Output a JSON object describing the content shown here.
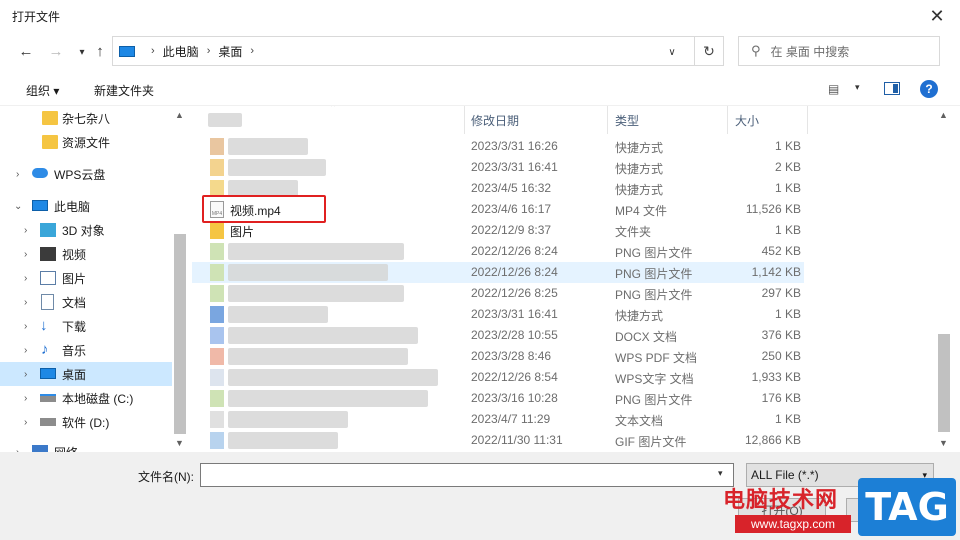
{
  "window": {
    "title": "打开文件"
  },
  "nav": {
    "back": "←",
    "forward": "→",
    "up": "↑",
    "refresh": "↻",
    "address_crumbs": [
      "此电脑",
      "桌面"
    ],
    "search_placeholder": "在 桌面 中搜索"
  },
  "toolbar": {
    "organize": "组织 ▾",
    "new_folder": "新建文件夹",
    "view_icon": "▤",
    "view_dd": "▾",
    "help": "?"
  },
  "sidebar": {
    "items": [
      {
        "label": "杂七杂八",
        "icon": "folder-icon"
      },
      {
        "label": "资源文件",
        "icon": "folder-icon"
      },
      {
        "label": "WPS云盘",
        "icon": "cloud-icon"
      },
      {
        "label": "此电脑",
        "icon": "pc-icon"
      },
      {
        "label": "3D 对象",
        "icon": "3d-objects-icon"
      },
      {
        "label": "视频",
        "icon": "video-icon"
      },
      {
        "label": "图片",
        "icon": "pictures-icon"
      },
      {
        "label": "文档",
        "icon": "documents-icon"
      },
      {
        "label": "下载",
        "icon": "download-icon"
      },
      {
        "label": "音乐",
        "icon": "music-icon"
      },
      {
        "label": "桌面",
        "icon": "desktop-icon"
      },
      {
        "label": "本地磁盘 (C:)",
        "icon": "drive-icon"
      },
      {
        "label": "软件 (D:)",
        "icon": "drive-icon"
      },
      {
        "label": "网络",
        "icon": "network-icon"
      }
    ]
  },
  "columns": {
    "name": "",
    "date": "修改日期",
    "type": "类型",
    "size": "大小"
  },
  "files": [
    {
      "name": "",
      "date": "2023/3/31 16:26",
      "type": "快捷方式",
      "size": "1 KB"
    },
    {
      "name": "",
      "date": "2023/3/31 16:41",
      "type": "快捷方式",
      "size": "2 KB"
    },
    {
      "name": "",
      "date": "2023/4/5 16:32",
      "type": "快捷方式",
      "size": "1 KB"
    },
    {
      "name": "视频.mp4",
      "date": "2023/4/6 16:17",
      "type": "MP4 文件",
      "size": "11,526 KB"
    },
    {
      "name": "图片",
      "date": "2022/12/9 8:37",
      "type": "文件夹",
      "size": "1 KB"
    },
    {
      "name": "",
      "date": "2022/12/26 8:24",
      "type": "PNG 图片文件",
      "size": "452 KB"
    },
    {
      "name": "",
      "date": "2022/12/26 8:24",
      "type": "PNG 图片文件",
      "size": "1,142 KB"
    },
    {
      "name": "",
      "date": "2022/12/26 8:25",
      "type": "PNG 图片文件",
      "size": "297 KB"
    },
    {
      "name": "",
      "date": "2023/3/31 16:41",
      "type": "快捷方式",
      "size": "1 KB"
    },
    {
      "name": "",
      "date": "2023/2/28 10:55",
      "type": "DOCX 文档",
      "size": "376 KB"
    },
    {
      "name": "",
      "date": "2023/3/28 8:46",
      "type": "WPS PDF 文档",
      "size": "250 KB"
    },
    {
      "name": "",
      "date": "2022/12/26 8:54",
      "type": "WPS文字 文档",
      "size": "1,933 KB"
    },
    {
      "name": "",
      "date": "2023/3/16 10:28",
      "type": "PNG 图片文件",
      "size": "176 KB"
    },
    {
      "name": "",
      "date": "2023/4/7 11:29",
      "type": "文本文档",
      "size": "1 KB"
    },
    {
      "name": "",
      "date": "2022/11/30 11:31",
      "type": "GIF 图片文件",
      "size": "12,866 KB"
    }
  ],
  "bottom": {
    "filename_label": "文件名(N):",
    "filename_value": "",
    "filetype": "ALL File (*.*)",
    "open_button": "打开(O)",
    "cancel_button": "取消"
  },
  "watermark": {
    "site_name": "电脑技术网",
    "url": "www.tagxp.com",
    "tag": "TAG"
  }
}
